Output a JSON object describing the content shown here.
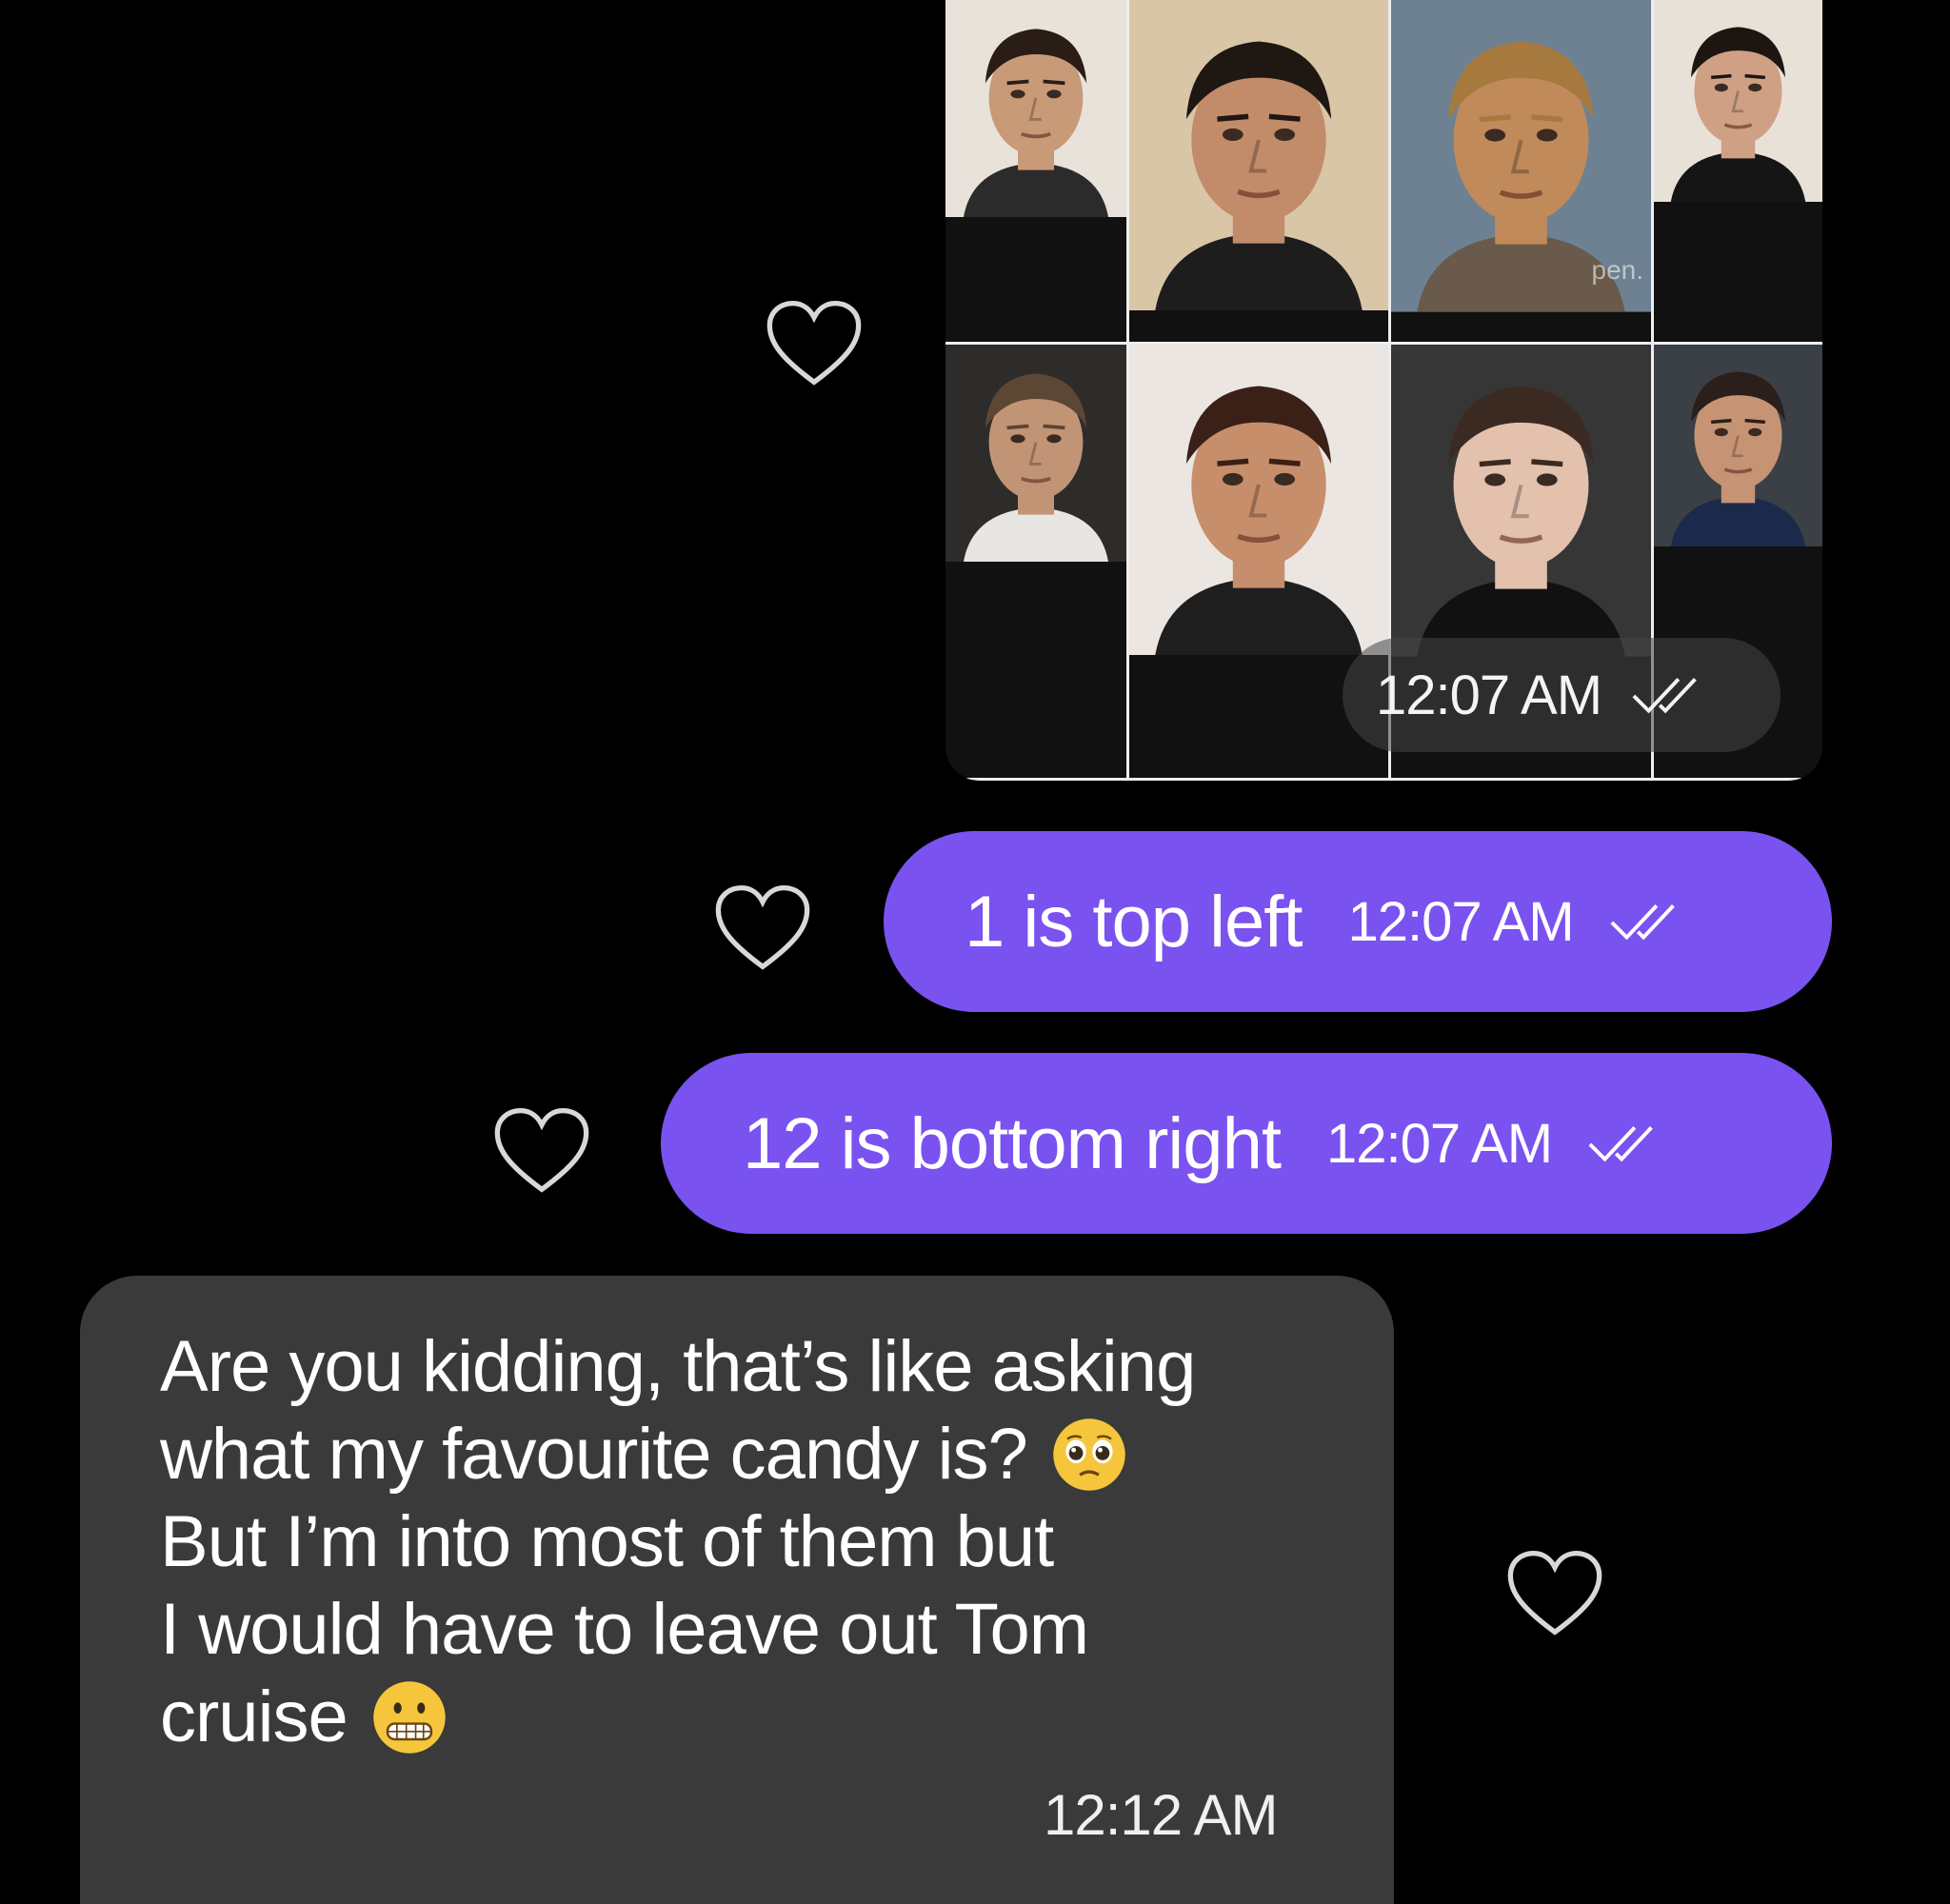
{
  "photo_message": {
    "time": "12:07 AM",
    "status_icon": "double-check-icon",
    "watermark": "pen.",
    "tiles": [
      {
        "skin": "#c99a78",
        "hair": "#2a1d17",
        "bg": "#e9e2da",
        "shirt": "#2b2b2b"
      },
      {
        "skin": "#c28c6a",
        "hair": "#1f1712",
        "bg": "#d9c6a6",
        "shirt": "#1d1d1d"
      },
      {
        "skin": "#c08a5a",
        "hair": "#a67a3e",
        "bg": "#6d8193",
        "shirt": "#6a5a4b"
      },
      {
        "skin": "#cfa084",
        "hair": "#1c1512",
        "bg": "#e8e1d7",
        "shirt": "#151515"
      },
      {
        "skin": "#c29476",
        "hair": "#5c4634",
        "bg": "#2e2c2a",
        "shirt": "#e8e6e2"
      },
      {
        "skin": "#c78e6c",
        "hair": "#3a2016",
        "bg": "#ece6e2",
        "shirt": "#1e1e1e"
      },
      {
        "skin": "#e3c1ad",
        "hair": "#3a2a22",
        "bg": "#363636",
        "shirt": "#111"
      },
      {
        "skin": "#c69474",
        "hair": "#2a1f1a",
        "bg": "#3b3f46",
        "shirt": "#1b2a4a"
      }
    ]
  },
  "messages_out": [
    {
      "text": "1 is top left",
      "time": "12:07 AM",
      "status_icon": "double-check-icon"
    },
    {
      "text": "12 is bottom right",
      "time": "12:07 AM",
      "status_icon": "double-check-icon"
    }
  ],
  "message_in": {
    "lines": [
      "Are you kidding, that’s like asking",
      "what my favourite candy is?",
      "But I’m into most of them but",
      "I would have to leave out Tom",
      "cruise"
    ],
    "emojis": [
      "pleading-face-emoji",
      "grimacing-face-emoji"
    ],
    "time": "12:12 AM"
  },
  "react_icon": "heart-outline-icon",
  "colors": {
    "outgoing_bubble": "#7a52ef",
    "incoming_bubble": "#3a3a3a",
    "background": "#000000"
  }
}
